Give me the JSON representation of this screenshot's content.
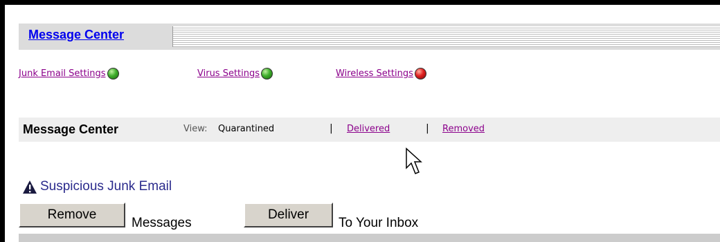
{
  "header": {
    "title": "Message Center"
  },
  "settings": {
    "items": [
      {
        "label": "Junk Email Settings",
        "status": "green"
      },
      {
        "label": "Virus Settings",
        "status": "green"
      },
      {
        "label": "Wireless Settings",
        "status": "red"
      }
    ]
  },
  "message_center": {
    "title": "Message Center",
    "view_label": "View:",
    "current_view": "Quarantined",
    "separator": "|",
    "delivered_link": "Delivered",
    "removed_link": "Removed"
  },
  "junk_section": {
    "heading": "Suspicious Junk Email",
    "icon": "warning-icon",
    "remove_button": "Remove",
    "remove_suffix": "Messages",
    "deliver_button": "Deliver",
    "deliver_suffix": "To Your Inbox"
  },
  "colors": {
    "status_green": "#3fae2c",
    "status_red": "#e02020",
    "link_visited": "#8b008b",
    "link_title": "#0000ee"
  }
}
